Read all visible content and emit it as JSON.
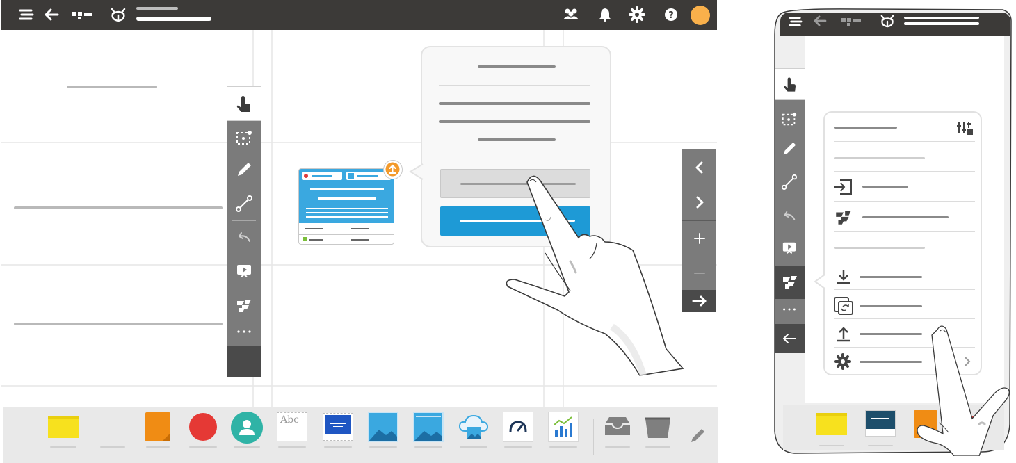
{
  "topbar": {
    "icons": [
      "menu-icon",
      "back-arrow-icon",
      "grid-dots-icon",
      "wolf-logo-icon",
      "people-icon",
      "bell-icon",
      "gear-icon",
      "help-icon",
      "avatar-circle"
    ],
    "bg_color": "#3c3a38",
    "avatar_color": "#f9b04b"
  },
  "left_toolbar": {
    "tools": [
      "hand-pointer-icon",
      "select-area-icon",
      "pen-icon",
      "connector-icon",
      "undo-icon",
      "present-icon",
      "apps-icon",
      "more-dots-icon"
    ]
  },
  "right_nav": {
    "buttons": [
      "chevron-left-icon",
      "chevron-right-icon",
      "plus-icon",
      "minus-icon",
      "arrow-right-icon"
    ]
  },
  "popup": {
    "buttons": [
      "secondary-button",
      "primary-button"
    ],
    "accent": "#1e9ad6"
  },
  "card": {
    "badge_color": "#f39a2b",
    "accent": "#3aa8e0"
  },
  "bottom_dock": {
    "items": [
      "sticky-note-yellow",
      "blank-item",
      "sticky-note-orange",
      "red-circle",
      "avatar-item",
      "text-abc-item",
      "blue-card-item",
      "image-item",
      "gallery-item",
      "cloud-image-item",
      "gauge-item",
      "chart-item",
      "inbox-item",
      "trash-item",
      "pen-item"
    ],
    "text_label": "Abc"
  },
  "tablet": {
    "menu_icons": [
      "settings-sliders-icon",
      "import-icon",
      "apps-icon",
      "download-icon",
      "copy-icon",
      "upload-icon",
      "gear-icon"
    ],
    "sidebar_icons": [
      "hand-pointer-icon",
      "select-area-icon",
      "pen-icon",
      "connector-icon",
      "undo-icon",
      "present-icon",
      "apps-icon",
      "more-dots-icon",
      "back-arrow-icon"
    ]
  }
}
